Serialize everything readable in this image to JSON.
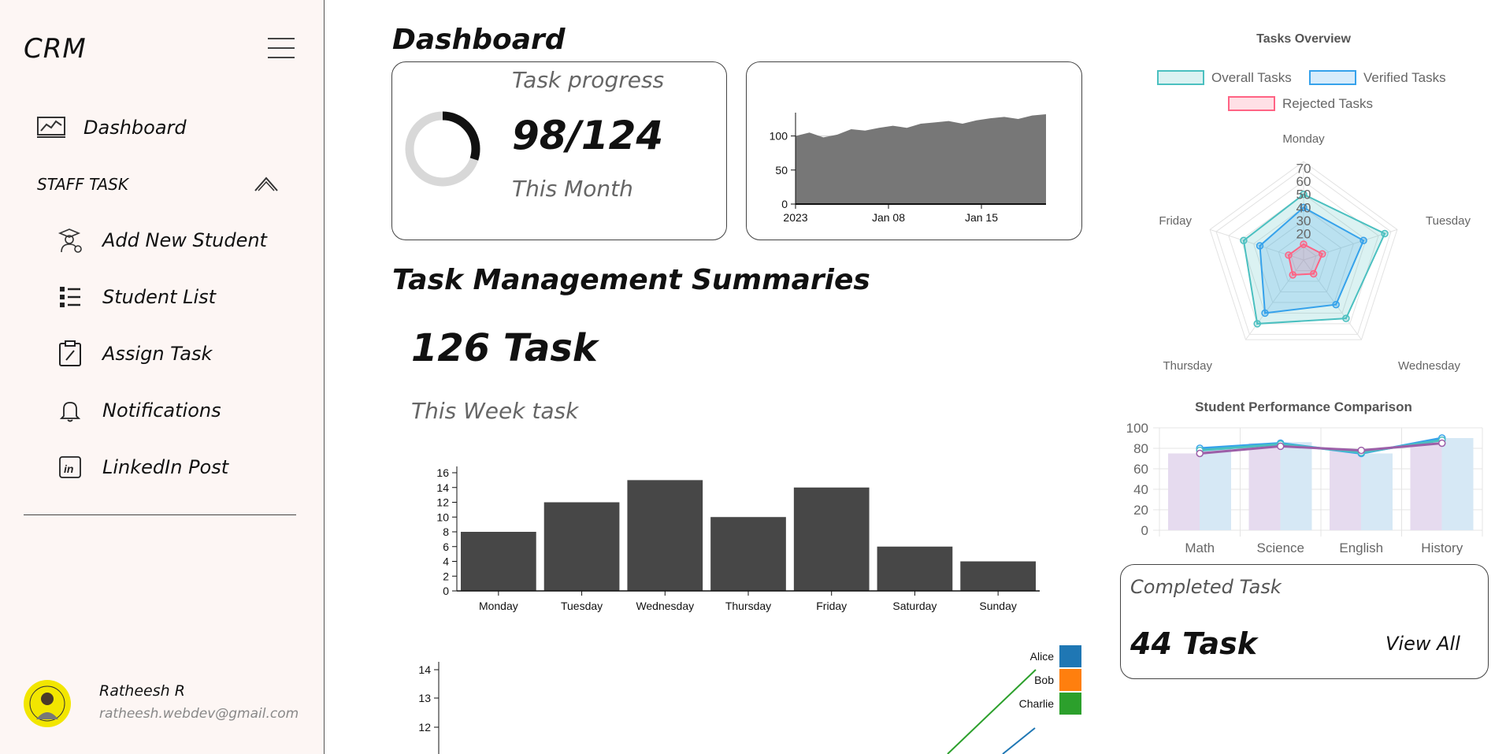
{
  "sidebar": {
    "logo": "CRM",
    "items": [
      {
        "label": "Dashboard",
        "icon": "chart-icon"
      },
      {
        "label": "Add New Student",
        "icon": "student-add-icon"
      },
      {
        "label": "Student List",
        "icon": "list-icon"
      },
      {
        "label": "Assign Task",
        "icon": "clipboard-icon"
      },
      {
        "label": "Notifications",
        "icon": "bell-icon"
      },
      {
        "label": "LinkedIn Post",
        "icon": "linkedin-icon"
      }
    ],
    "section_label": "STAFF TASK",
    "user": {
      "name": "Ratheesh R",
      "email": "ratheesh.webdev@gmail.com"
    }
  },
  "main": {
    "title": "Dashboard",
    "task_progress": {
      "label": "Task progress",
      "value": "98/124",
      "period": "This Month",
      "completed": 98,
      "total": 124
    },
    "summaries_title": "Task Management Summaries",
    "week": {
      "count": "126 Task",
      "label": "This Week task"
    },
    "completed": {
      "label": "Completed Task",
      "value": "44 Task",
      "link": "View All"
    }
  },
  "chart_data": [
    {
      "type": "area",
      "x_ticks": [
        "2023",
        "Jan 08",
        "Jan 15"
      ],
      "y_ticks": [
        0,
        50,
        100
      ],
      "ylim": [
        0,
        100
      ],
      "values": [
        100,
        105,
        98,
        102,
        110,
        108,
        112,
        115,
        112,
        118,
        120,
        122,
        118,
        123,
        126,
        128,
        125,
        130,
        132
      ]
    },
    {
      "type": "bar",
      "categories": [
        "Monday",
        "Tuesday",
        "Wednesday",
        "Thursday",
        "Friday",
        "Saturday",
        "Sunday"
      ],
      "values": [
        8,
        12,
        15,
        10,
        14,
        6,
        4
      ],
      "y_ticks": [
        0,
        2,
        4,
        6,
        8,
        10,
        12,
        14,
        16
      ],
      "ylim": [
        0,
        16
      ]
    },
    {
      "type": "line",
      "y_ticks": [
        12,
        13,
        14
      ],
      "legend": [
        "Alice",
        "Bob",
        "Charlie"
      ],
      "colors": [
        "#1f77b4",
        "#ff7f0e",
        "#2ca02c"
      ]
    },
    {
      "type": "radar",
      "title": "Tasks Overview",
      "categories": [
        "Monday",
        "Tuesday",
        "Wednesday",
        "Thursday",
        "Friday"
      ],
      "r_ticks": [
        20,
        30,
        40,
        50,
        60,
        70
      ],
      "series": [
        {
          "name": "Overall Tasks",
          "values": [
            50,
            65,
            55,
            60,
            48
          ],
          "color": "#4bc0c0"
        },
        {
          "name": "Verified Tasks",
          "values": [
            40,
            48,
            42,
            50,
            35
          ],
          "color": "#36a2eb"
        },
        {
          "name": "Rejected Tasks",
          "values": [
            12,
            15,
            13,
            14,
            12
          ],
          "color": "#ff6384"
        }
      ]
    },
    {
      "type": "bar",
      "title": "Student Performance Comparison",
      "categories": [
        "Math",
        "Science",
        "English",
        "History"
      ],
      "y_ticks": [
        0,
        20,
        40,
        60,
        80,
        100
      ],
      "ylim": [
        0,
        100
      ],
      "bars": [
        {
          "values": [
            75,
            85,
            78,
            85
          ],
          "color": "#e6dbef"
        },
        {
          "values": [
            80,
            86,
            75,
            90
          ],
          "color": "#d6e8f5"
        }
      ],
      "lines": [
        {
          "values": [
            80,
            85,
            75,
            90
          ],
          "color": "#36a2eb"
        },
        {
          "values": [
            78,
            84,
            76,
            88
          ],
          "color": "#4bc0c0"
        },
        {
          "values": [
            75,
            82,
            78,
            85
          ],
          "color": "#9c5fa8"
        }
      ]
    }
  ]
}
